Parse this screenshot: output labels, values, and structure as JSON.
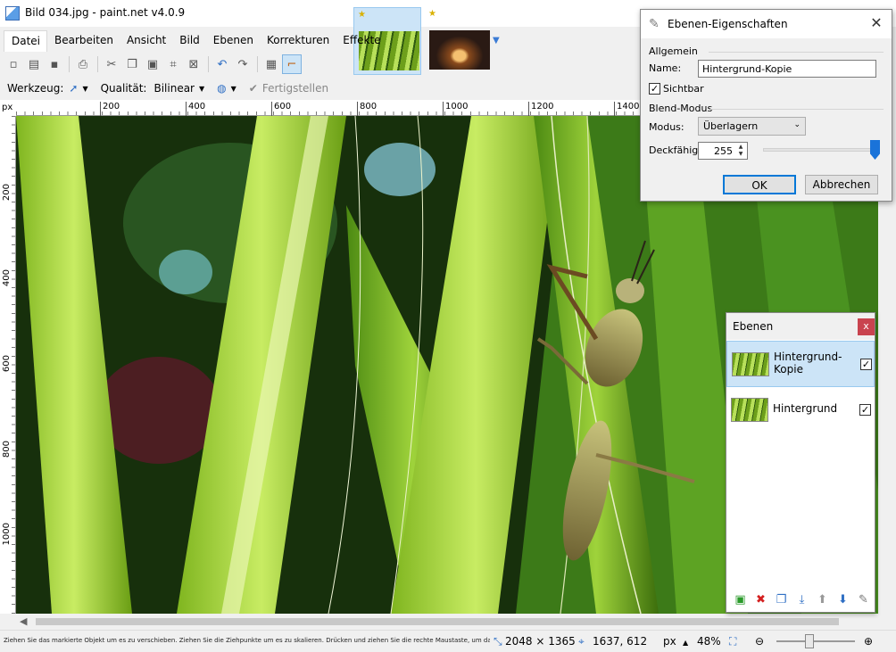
{
  "window": {
    "title": "Bild 034.jpg - paint.net v4.0.9"
  },
  "menu": [
    "Datei",
    "Bearbeiten",
    "Ansicht",
    "Bild",
    "Ebenen",
    "Korrekturen",
    "Effekte"
  ],
  "toolbar": {
    "icons": [
      "new-icon",
      "open-icon",
      "save-icon",
      "print-icon",
      "cut-icon",
      "copy-icon",
      "paste-icon",
      "crop-icon",
      "deselect-icon",
      "undo-icon",
      "redo-icon",
      "grid-icon",
      "rulers-icon"
    ]
  },
  "tool_options": {
    "tool_label": "Werkzeug:",
    "quality_label": "Qualität:",
    "quality_value": "Bilinear",
    "finish_label": "Fertigstellen"
  },
  "ruler": {
    "unit": "px",
    "h_labels": [
      "200",
      "400",
      "600",
      "800",
      "1000",
      "1200",
      "1400"
    ],
    "v_labels": [
      "200",
      "400",
      "600",
      "800",
      "1000"
    ]
  },
  "status": {
    "hint": "Ziehen Sie das markierte Objekt um es zu verschieben. Ziehen Sie die Ziehpunkte um es zu skalieren. Drücken und ziehen Sie die rechte Maustaste, um das Objekt zu dreh...",
    "image_size": "2048 × 1365",
    "cursor_pos": "1637, 612",
    "unit": "px",
    "zoom": "48%"
  },
  "dialog": {
    "title": "Ebenen-Eigenschaften",
    "group_general": "Allgemein",
    "name_label": "Name:",
    "name_value": "Hintergrund-Kopie",
    "visible_label": "Sichtbar",
    "visible_checked": "✓",
    "group_blend": "Blend-Modus",
    "mode_label": "Modus:",
    "mode_value": "Überlagern",
    "opacity_label": "Deckfähigk",
    "opacity_value": "255",
    "ok_label": "OK",
    "cancel_label": "Abbrechen"
  },
  "layers": {
    "title": "Ebenen",
    "items": [
      {
        "name": "Hintergrund-Kopie",
        "checked": "✓"
      },
      {
        "name": "Hintergrund",
        "checked": "✓"
      }
    ]
  }
}
